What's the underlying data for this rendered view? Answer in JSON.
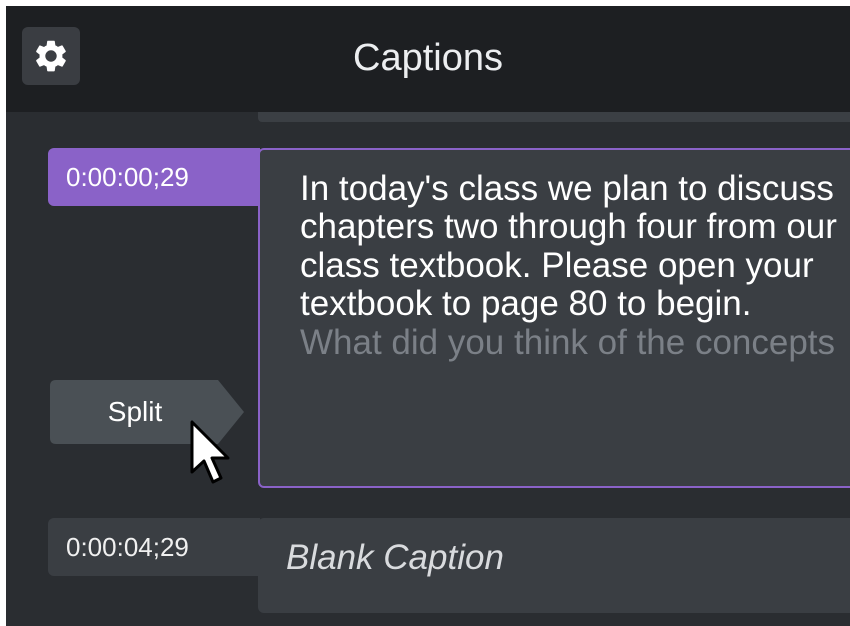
{
  "header": {
    "title": "Captions",
    "settings_icon": "gear-icon"
  },
  "captions": [
    {
      "timestamp": "0:00:00;29",
      "text_active": "In today's class we plan to discuss chapters two through four from our class textbook. Please open your textbook to page 80 to begin.",
      "text_overflow": "What did you think of the concepts",
      "selected": true
    },
    {
      "timestamp": "0:00:04;29",
      "text": "Blank Caption",
      "selected": false
    }
  ],
  "split_button": {
    "label": "Split"
  },
  "colors": {
    "accent": "#8a62c8",
    "panel_bg": "#2a2d31",
    "header_bg": "#1d1f22",
    "card_bg": "#3a3e43",
    "dim_text": "#7b8087"
  }
}
